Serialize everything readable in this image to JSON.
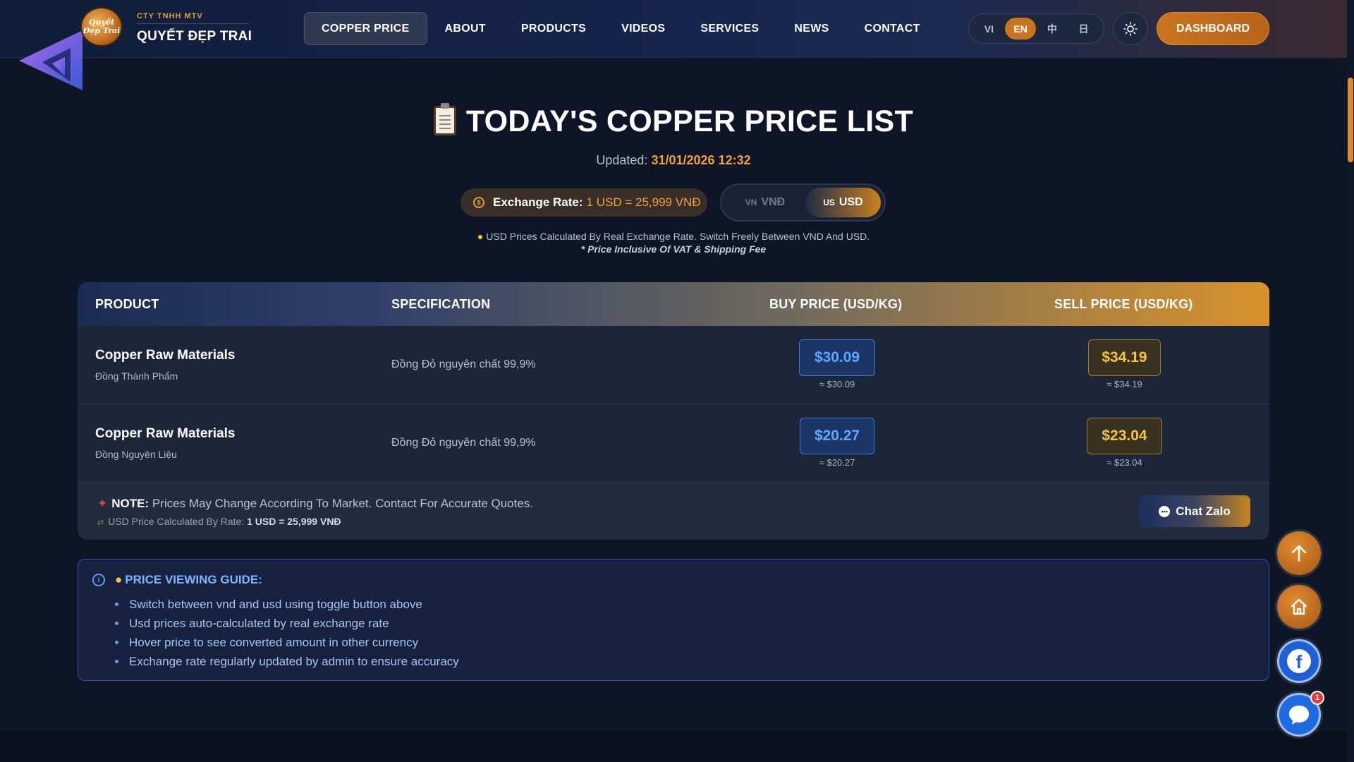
{
  "header": {
    "company_small": "CTY TNHH MTV",
    "company_name": "QUYẾT ĐẸP TRAI",
    "logo_badge_text": "Quyết Đẹp Trai",
    "nav": [
      {
        "label": "COPPER PRICE",
        "active": true
      },
      {
        "label": "ABOUT"
      },
      {
        "label": "PRODUCTS"
      },
      {
        "label": "VIDEOS"
      },
      {
        "label": "SERVICES"
      },
      {
        "label": "NEWS"
      },
      {
        "label": "CONTACT"
      }
    ],
    "languages": [
      "VI",
      "EN",
      "中",
      "日"
    ],
    "active_language": "EN",
    "dashboard_label": "DASHBOARD",
    "theme_icon": "sun-icon"
  },
  "page": {
    "title": "TODAY'S COPPER PRICE LIST",
    "title_icon": "clipboard-icon",
    "updated_label": "Updated:",
    "updated_value": "31/01/2026 12:32",
    "exchange_label": "Exchange Rate:",
    "exchange_value": "1 USD = 25,999 VNĐ",
    "currency_toggle": {
      "vnd_flag": "VN",
      "vnd_label": "VNĐ",
      "usd_flag": "US",
      "usd_label": "USD",
      "active": "USD"
    },
    "hint": "USD Prices Calculated By Real Exchange Rate. Switch Freely Between VND And USD.",
    "vat_note": "* Price Inclusive Of VAT & Shipping Fee"
  },
  "table": {
    "columns": [
      "PRODUCT",
      "SPECIFICATION",
      "BUY PRICE (USD/KG)",
      "SELL PRICE (USD/KG)"
    ],
    "rows": [
      {
        "name": "Copper Raw Materials",
        "sub": "Đồng Thành Phẩm",
        "spec": "Đồng Đỏ nguyên chất 99,9%",
        "buy": "$30.09",
        "buy_approx": "≈ $30.09",
        "sell": "$34.19",
        "sell_approx": "≈ $34.19"
      },
      {
        "name": "Copper Raw Materials",
        "sub": "Đồng Nguyên Liệu",
        "spec": "Đồng Đỏ nguyên chất 99,9%",
        "buy": "$20.27",
        "buy_approx": "≈ $20.27",
        "sell": "$23.04",
        "sell_approx": "≈ $23.04"
      }
    ],
    "note_label": "NOTE:",
    "note_text": "Prices May Change According To Market. Contact For Accurate Quotes.",
    "rate_note_label": "USD Price Calculated By Rate:",
    "rate_note_value": "1 USD = 25,999 VNĐ",
    "chat_button": "Chat Zalo"
  },
  "guide": {
    "title": "PRICE VIEWING GUIDE:",
    "items": [
      "Switch between vnd and usd using toggle button above",
      "Usd prices auto-calculated by real exchange rate",
      "Hover price to see converted amount in other currency",
      "Exchange rate regularly updated by admin to ensure accuracy"
    ]
  },
  "floating": {
    "chat_badge_count": "1"
  },
  "colors": {
    "accent_orange": "#d9922c",
    "buy_blue": "#5fa7ff",
    "sell_gold": "#f5c53a",
    "background": "#0d1526"
  }
}
